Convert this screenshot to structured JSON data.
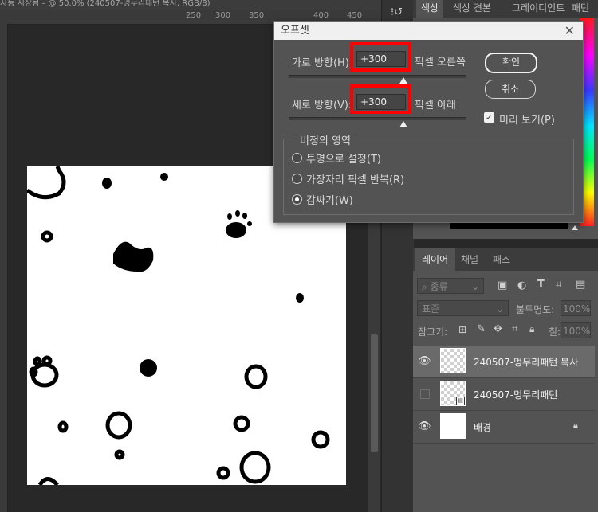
{
  "document": {
    "tab_title": "자동 저장됨 – @ 50.0% (240507-멍무리패턴 복사, RGB/8)",
    "ruler_ticks": [
      "250",
      "300",
      "350",
      "400",
      "450"
    ]
  },
  "color_panel": {
    "tabs": [
      "색상",
      "색상 견본",
      "그레이디언트",
      "패턴"
    ]
  },
  "layers_panel": {
    "tabs": [
      "레이어",
      "채널",
      "패스"
    ],
    "filter_label": "종류",
    "blend_mode": "표준",
    "opacity_label": "불투명도:",
    "opacity_value": "100%",
    "lock_label": "잠그기:",
    "fill_label": "칠:",
    "fill_value": "100%",
    "layers": [
      {
        "name": "240507-멍무리패턴 복사",
        "visible": true,
        "selected": true
      },
      {
        "name": "240507-멍무리패턴",
        "visible": false,
        "selected": false
      },
      {
        "name": "배경",
        "visible": true,
        "selected": false,
        "locked": true
      }
    ]
  },
  "dialog": {
    "title": "오프셋",
    "horizontal_label": "가로 방향(H):",
    "horizontal_value": "+300",
    "horizontal_unit": "픽셀 오른쪽",
    "vertical_label": "세로 방향(V):",
    "vertical_value": "+300",
    "vertical_unit": "픽셀 아래",
    "ok_button": "확인",
    "cancel_button": "취소",
    "preview_label": "미리 보기(P)",
    "preview_checked": true,
    "undefined_area_label": "비정의 영역",
    "options": [
      {
        "label": "투명으로 설정(T)",
        "selected": false
      },
      {
        "label": "가장자리 픽셀 반복(R)",
        "selected": false
      },
      {
        "label": "감싸기(W)",
        "selected": true
      }
    ],
    "highlight_color": "#ff0000"
  }
}
